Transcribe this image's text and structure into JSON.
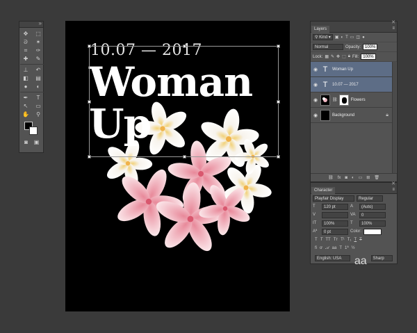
{
  "tools": {
    "icons": [
      "move-icon",
      "marquee-icon",
      "lasso-icon",
      "magic-wand-icon",
      "crop-icon",
      "eyedropper-icon",
      "healing-brush-icon",
      "brush-icon",
      "clone-stamp-icon",
      "history-brush-icon",
      "eraser-icon",
      "gradient-icon",
      "blur-icon",
      "dodge-icon",
      "pen-icon",
      "type-icon",
      "path-selection-icon",
      "rectangle-icon",
      "hand-icon",
      "zoom-icon"
    ],
    "glyphs": [
      "✥",
      "⬚",
      "ᘐ",
      "✶",
      "⌗",
      "✑",
      "✚",
      "✎",
      "⊥",
      "↶",
      "◧",
      "▤",
      "●",
      "◐",
      "✒",
      "T",
      "↖",
      "▭",
      "✋",
      "⚲"
    ]
  },
  "canvas": {
    "date": "10.07 — 2017",
    "headline_line1": "Woman",
    "headline_line2": "Up"
  },
  "layers_panel": {
    "tab": "Layers",
    "kind_filter": "Kind",
    "blend_mode": "Normal",
    "opacity_label": "Opacity:",
    "opacity_value": "100%",
    "lock_label": "Lock:",
    "fill_label": "Fill:",
    "fill_value": "100%",
    "layers": [
      {
        "name": "Woman Up",
        "type": "text",
        "selected": true
      },
      {
        "name": "10.07 — 2017",
        "type": "text",
        "selected": true
      },
      {
        "name": "Flowers",
        "type": "image",
        "selected": false
      },
      {
        "name": "Background",
        "type": "fill",
        "selected": false
      }
    ]
  },
  "character_panel": {
    "tab": "Character",
    "font_family": "Playfair Display",
    "font_style": "Regular",
    "font_size": "120 pt",
    "leading": "(Auto)",
    "kerning": "",
    "tracking": "0",
    "vertical_scale": "100%",
    "horizontal_scale": "100%",
    "baseline_shift": "0 pt",
    "color_label": "Color:",
    "language": "English: USA",
    "antialias": "Sharp",
    "color": "#ffffff"
  }
}
